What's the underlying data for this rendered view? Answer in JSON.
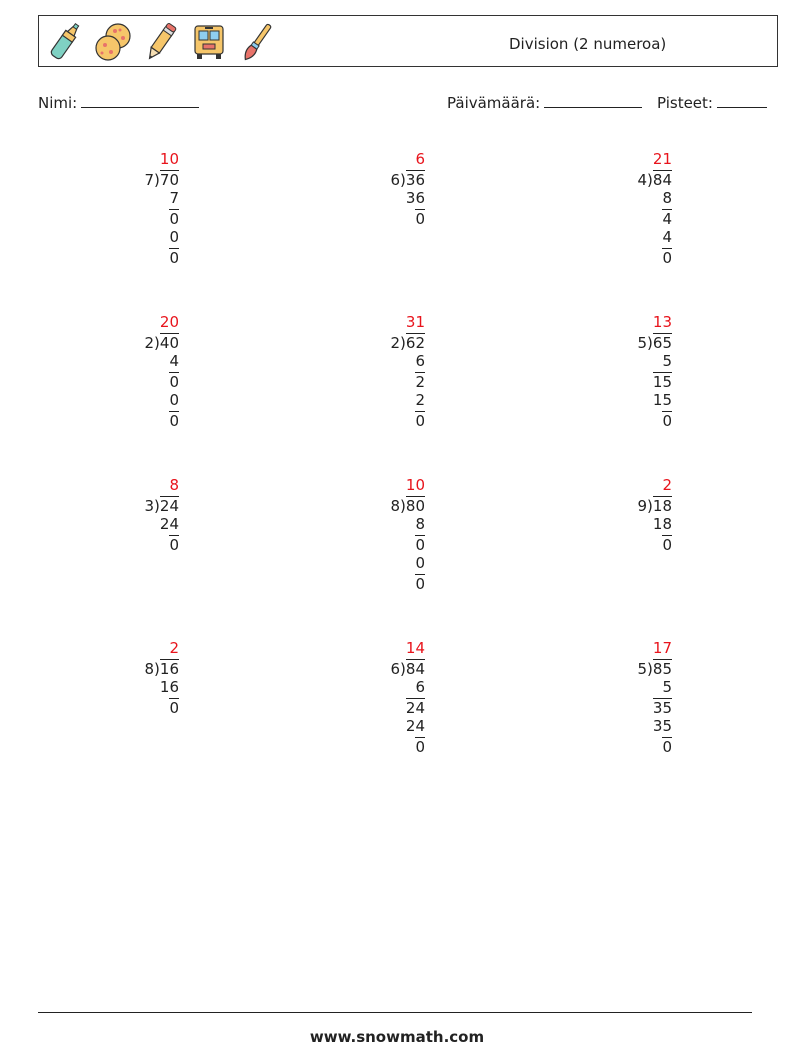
{
  "header": {
    "icons": [
      "highlighter-icon",
      "cookies-icon",
      "pencil-icon",
      "school-bus-icon",
      "paintbrush-icon"
    ],
    "title": "Division (2 numeroa)"
  },
  "fields": {
    "name_label": "Nimi:",
    "date_label": "Päivämäärä:",
    "score_label": "Pisteet:"
  },
  "colors": {
    "answer": "#e8141c",
    "text": "#222222"
  },
  "problems": [
    {
      "divisor": "7",
      "dividend": "70",
      "quotient": "10",
      "steps": [
        {
          "text": "7",
          "bar": false
        },
        {
          "text": "0",
          "bar": true
        },
        {
          "text": "0",
          "bar": false
        },
        {
          "text": "0",
          "bar": true
        }
      ]
    },
    {
      "divisor": "6",
      "dividend": "36",
      "quotient": "6",
      "steps": [
        {
          "text": "36",
          "bar": false
        },
        {
          "text": "0",
          "bar": true
        }
      ]
    },
    {
      "divisor": "4",
      "dividend": "84",
      "quotient": "21",
      "steps": [
        {
          "text": "8",
          "bar": false
        },
        {
          "text": "4",
          "bar": true
        },
        {
          "text": "4",
          "bar": false
        },
        {
          "text": "0",
          "bar": true
        }
      ]
    },
    {
      "divisor": "2",
      "dividend": "40",
      "quotient": "20",
      "steps": [
        {
          "text": "4",
          "bar": false
        },
        {
          "text": "0",
          "bar": true
        },
        {
          "text": "0",
          "bar": false
        },
        {
          "text": "0",
          "bar": true
        }
      ]
    },
    {
      "divisor": "2",
      "dividend": "62",
      "quotient": "31",
      "steps": [
        {
          "text": "6",
          "bar": false
        },
        {
          "text": "2",
          "bar": true
        },
        {
          "text": "2",
          "bar": false
        },
        {
          "text": "0",
          "bar": true
        }
      ]
    },
    {
      "divisor": "5",
      "dividend": "65",
      "quotient": "13",
      "steps": [
        {
          "text": "5",
          "bar": false
        },
        {
          "text": "15",
          "bar": true
        },
        {
          "text": "15",
          "bar": false
        },
        {
          "text": "0",
          "bar": true
        }
      ]
    },
    {
      "divisor": "3",
      "dividend": "24",
      "quotient": "8",
      "steps": [
        {
          "text": "24",
          "bar": false
        },
        {
          "text": "0",
          "bar": true
        }
      ]
    },
    {
      "divisor": "8",
      "dividend": "80",
      "quotient": "10",
      "steps": [
        {
          "text": "8",
          "bar": false
        },
        {
          "text": "0",
          "bar": true
        },
        {
          "text": "0",
          "bar": false
        },
        {
          "text": "0",
          "bar": true
        }
      ]
    },
    {
      "divisor": "9",
      "dividend": "18",
      "quotient": "2",
      "steps": [
        {
          "text": "18",
          "bar": false
        },
        {
          "text": "0",
          "bar": true
        }
      ]
    },
    {
      "divisor": "8",
      "dividend": "16",
      "quotient": "2",
      "steps": [
        {
          "text": "16",
          "bar": false
        },
        {
          "text": "0",
          "bar": true
        }
      ]
    },
    {
      "divisor": "6",
      "dividend": "84",
      "quotient": "14",
      "steps": [
        {
          "text": "6",
          "bar": false
        },
        {
          "text": "24",
          "bar": true
        },
        {
          "text": "24",
          "bar": false
        },
        {
          "text": "0",
          "bar": true
        }
      ]
    },
    {
      "divisor": "5",
      "dividend": "85",
      "quotient": "17",
      "steps": [
        {
          "text": "5",
          "bar": false
        },
        {
          "text": "35",
          "bar": true
        },
        {
          "text": "35",
          "bar": false
        },
        {
          "text": "0",
          "bar": true
        }
      ]
    }
  ],
  "footer": {
    "website": "www.snowmath.com"
  }
}
